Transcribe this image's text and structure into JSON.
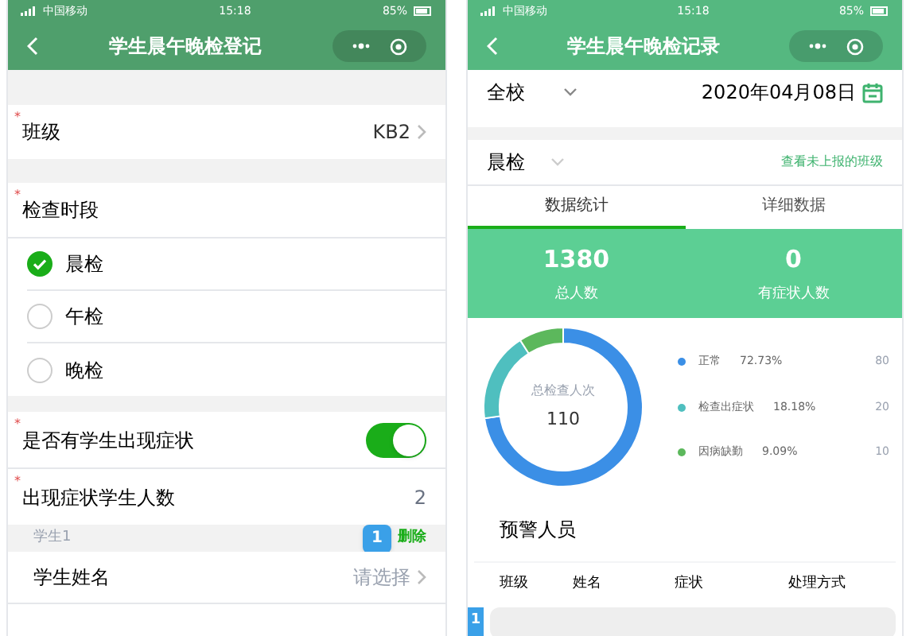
{
  "registration_screen": {
    "status_bar": {
      "carrier": "中国移动",
      "time": "15:18",
      "battery": "85%"
    },
    "title": "学生晨午晚检登记",
    "class_field": {
      "label": "班级",
      "marker": "*",
      "value": "KB2"
    },
    "period": {
      "label": "检查时段",
      "marker": "*",
      "options": [
        {
          "label": "晨检",
          "selected": true
        },
        {
          "label": "午检",
          "selected": false
        },
        {
          "label": "晚检",
          "selected": false
        }
      ]
    },
    "symptom_toggle": {
      "label": "是否有学生出现症状",
      "marker": "*",
      "on": true
    },
    "symptom_count": {
      "label": "出现症状学生人数",
      "marker": "*",
      "value": "2"
    },
    "student_header": {
      "label": "学生1",
      "badge": "1",
      "action": "删除"
    },
    "student_name": {
      "label": "学生姓名",
      "placeholder": "请选择"
    }
  },
  "records_screen": {
    "status_bar": {
      "carrier": "中国移动",
      "time": "15:18",
      "battery": "85%"
    },
    "title": "学生晨午晚检记录",
    "scope": "全校",
    "date": "2020年04月08日",
    "period": "晨检",
    "link": "查看未上报的班级",
    "tabs": [
      {
        "label": "数据统计",
        "selected": true
      },
      {
        "label": "详细数据",
        "selected": false
      }
    ],
    "stats": [
      {
        "value": "1380",
        "label": "总人数"
      },
      {
        "value": "0",
        "label": "有症状人数"
      }
    ],
    "donut": {
      "center_label": "总检查人次",
      "center_value": "110",
      "chart_data": {
        "type": "donut",
        "categories": [
          "正常",
          "检查出症状",
          "因病缺勤"
        ],
        "values": [
          72.73,
          18.18,
          9.09
        ]
      },
      "legend": [
        {
          "percent": "72.73%",
          "count": "80",
          "color": "#3b8fe6"
        },
        {
          "percent": "18.18%",
          "count": "20",
          "color": "#4fbfbf"
        },
        {
          "percent": "9.09%",
          "count": "10",
          "color": "#5cb85c"
        }
      ]
    },
    "warning_title": "预警人员",
    "table": {
      "badge": "1",
      "columns": [
        "班级",
        "姓名",
        "症状",
        "处理方式"
      ]
    }
  }
}
